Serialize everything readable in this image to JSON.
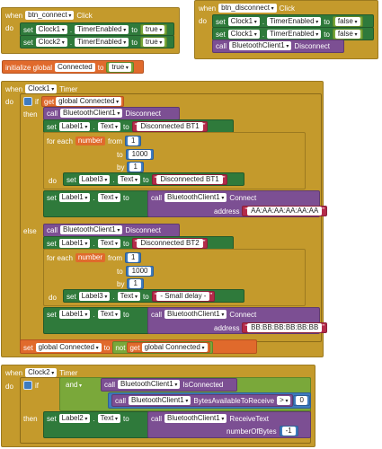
{
  "kw": {
    "when": "when",
    "do": "do",
    "set": "set",
    "to": "to",
    "call": "call",
    "if": "if",
    "then": "then",
    "else": "else",
    "for_each": "for each",
    "from": "from",
    "by": "by",
    "initialize_global": "initialize global",
    "get": "get",
    "not": "not",
    "and": "and",
    "address": "address",
    "number_of_bytes": "numberOfBytes"
  },
  "b1": {
    "component": "btn_connect",
    "event": "Click",
    "rows": [
      {
        "comp": "Clock1",
        "prop": "TimerEnabled",
        "val": "true"
      },
      {
        "comp": "Clock2",
        "prop": "TimerEnabled",
        "val": "true"
      }
    ]
  },
  "b2": {
    "component": "btn_disconnect",
    "event": "Click",
    "rows": [
      {
        "comp": "Clock1",
        "prop": "TimerEnabled",
        "val": "false"
      },
      {
        "comp": "Clock1",
        "prop": "TimerEnabled",
        "val": "false"
      }
    ],
    "call_comp": "BluetoothClient1",
    "call_method": "Disconnect"
  },
  "init": {
    "name": "Connected",
    "val": "true"
  },
  "timer1": {
    "component": "Clock1",
    "event": "Timer",
    "cond": "global Connected",
    "then": {
      "call_comp": "BluetoothClient1",
      "call_method": "Disconnect",
      "set_label": "Label1",
      "set_prop": "Text",
      "set_text": "Disconnected BT1",
      "loop_var": "number",
      "from": "1",
      "to": "1000",
      "by": "1",
      "loop_label": "Label3",
      "loop_prop": "Text",
      "loop_text": "Disconnected BT1",
      "conn_label": "Label1",
      "conn_prop": "Text",
      "conn_comp": "BluetoothClient1",
      "conn_method": "Connect",
      "address": "AA:AA:AA:AA:AA:AA"
    },
    "else": {
      "call_comp": "BluetoothClient1",
      "call_method": "Disconnect",
      "set_label": "Label1",
      "set_prop": "Text",
      "set_text": "Disconnected BT2",
      "loop_var": "number",
      "from": "1",
      "to": "1000",
      "by": "1",
      "loop_label": "Label3",
      "loop_prop": "Text",
      "loop_text": " - Small delay - ",
      "conn_label": "Label1",
      "conn_prop": "Text",
      "conn_comp": "BluetoothClient1",
      "conn_method": "Connect",
      "address": "BB:BB:BB:BB:BB:BB"
    },
    "final_set": "global Connected",
    "final_get": "global Connected"
  },
  "timer2": {
    "component": "Clock2",
    "event": "Timer",
    "and_comp": "BluetoothClient1",
    "and_method": "IsConnected",
    "bytes_comp": "BluetoothClient1",
    "bytes_method": "BytesAvailableToReceive",
    "op": ">",
    "zero": "0",
    "label": "Label2",
    "prop": "Text",
    "recv_comp": "BluetoothClient1",
    "recv_method": "ReceiveText",
    "num": "-1"
  },
  "colors": {
    "event": "#c49a2c",
    "set": "#2f7a3b",
    "call": "#7c4f93",
    "var": "#e06a2c",
    "math": "#3e7bbf",
    "text": "#b42b4a",
    "logic": "#7aa83a"
  }
}
